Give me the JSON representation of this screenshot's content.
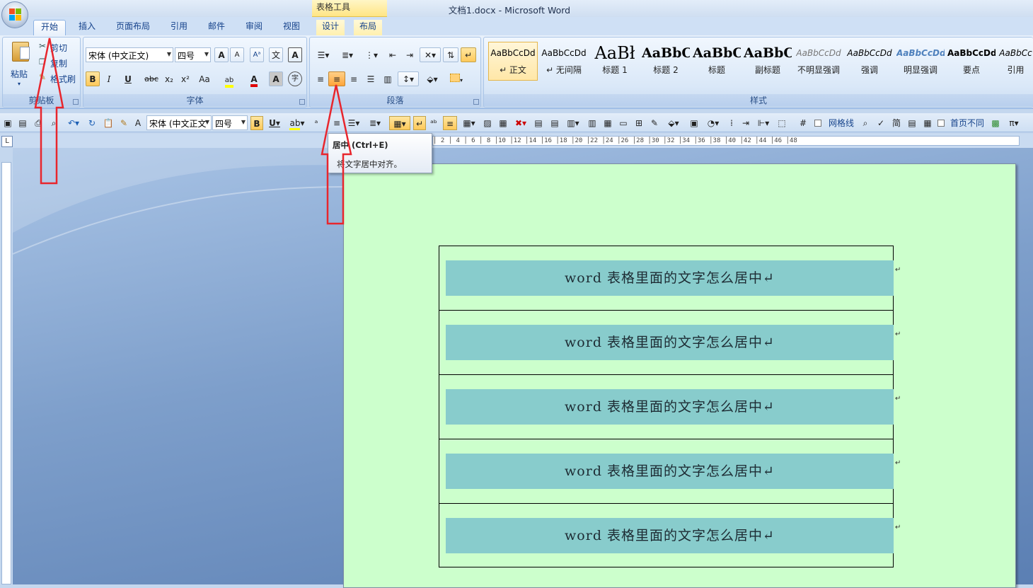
{
  "window": {
    "title": "文档1.docx - Microsoft Word",
    "context_tab_group": "表格工具"
  },
  "tabs": [
    {
      "label": "开始",
      "active": true
    },
    {
      "label": "插入"
    },
    {
      "label": "页面布局"
    },
    {
      "label": "引用"
    },
    {
      "label": "邮件"
    },
    {
      "label": "审阅"
    },
    {
      "label": "视图"
    },
    {
      "label": "设计"
    },
    {
      "label": "布局"
    }
  ],
  "ribbon": {
    "clipboard": {
      "label": "剪贴板",
      "paste": "粘贴",
      "cut": "剪切",
      "copy": "复制",
      "format_painter": "格式刷"
    },
    "font": {
      "label": "字体",
      "font_name": "宋体 (中文正文)",
      "font_size": "四号",
      "bold": "B",
      "italic": "I",
      "underline": "U",
      "strike": "abc",
      "subscript": "x₂",
      "superscript": "x²",
      "change_case": "Aa",
      "font_color_glyph": "A",
      "grow": "A",
      "shrink": "A",
      "char_shading": "A",
      "phonetic": "文",
      "enclose": "字"
    },
    "paragraph": {
      "label": "段落"
    },
    "styles": {
      "label": "样式",
      "items": [
        {
          "preview": "AaBbCcDd",
          "name": "↵ 正文"
        },
        {
          "preview": "AaBbCcDd",
          "name": "↵ 无间隔"
        },
        {
          "preview": "AaBł",
          "name": "标题 1"
        },
        {
          "preview": "AaBbC",
          "name": "标题 2"
        },
        {
          "preview": "AaBbC",
          "name": "标题"
        },
        {
          "preview": "AaBbC",
          "name": "副标题"
        },
        {
          "preview": "AaBbCcDd",
          "name": "不明显强调"
        },
        {
          "preview": "AaBbCcDd",
          "name": "强调"
        },
        {
          "preview": "AaBbCcDd",
          "name": "明显强调"
        },
        {
          "preview": "AaBbCcDd",
          "name": "要点"
        },
        {
          "preview": "AaBbCc",
          "name": "引用"
        }
      ]
    }
  },
  "qat": {
    "font_name": "宋体 (中文正文",
    "font_size": "四号",
    "gridlines": "网格线",
    "first_page_diff": "首页不同",
    "pi": "π"
  },
  "tooltip": {
    "title": "居中 (Ctrl+E)",
    "description": "将文字居中对齐。"
  },
  "ruler": {
    "ticks": "│ 2 │ 4 │ 6 │ 8 │10 │12 │14 │16 │18 │20 │22 │24 │26 │28 │30 │32 │34 │36 │38 │40 │42 │44 │46 │48",
    "corner": "L"
  },
  "document": {
    "rows": [
      "word 表格里面的文字怎么居中↵",
      "word 表格里面的文字怎么居中↵",
      "word 表格里面的文字怎么居中↵",
      "word 表格里面的文字怎么居中↵",
      "word 表格里面的文字怎么居中↵"
    ],
    "row_mark": "↵",
    "page_color": "#ccffcc",
    "cell_shading": "#88cccc"
  },
  "colors": {
    "annotation_arrow": "#e8262d",
    "ribbon": "#dae8f8",
    "accent_selected": "#ffc95a"
  }
}
